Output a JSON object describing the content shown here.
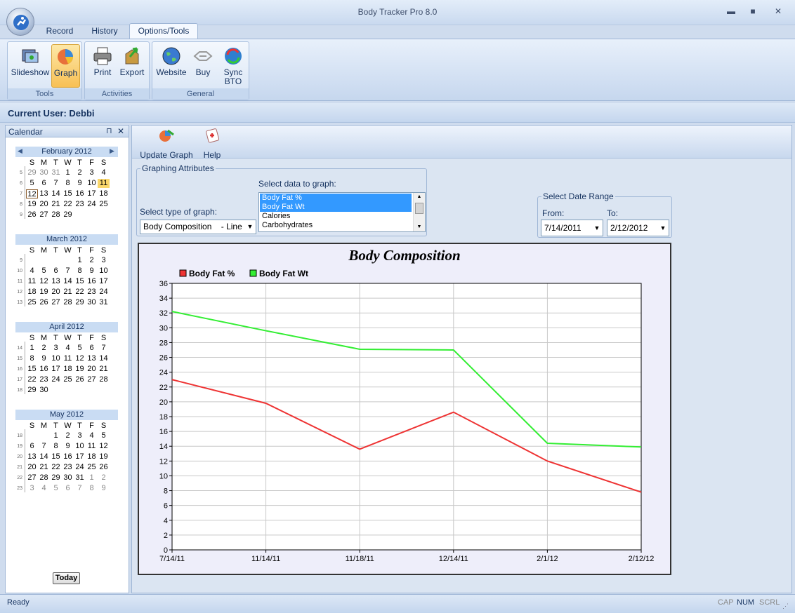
{
  "app": {
    "title": "Body Tracker Pro 8.0"
  },
  "window": {
    "minimize": "▬",
    "maximize": "■",
    "close": "✕"
  },
  "tabs": [
    {
      "label": "Record"
    },
    {
      "label": "History"
    },
    {
      "label": "Options/Tools",
      "active": true
    }
  ],
  "ribbon": {
    "groups": [
      {
        "label": "Tools",
        "buttons": [
          {
            "label": "Slideshow",
            "icon": "slideshow-icon"
          },
          {
            "label": "Graph",
            "icon": "graph-icon",
            "active": true
          }
        ]
      },
      {
        "label": "Activities",
        "buttons": [
          {
            "label": "Print",
            "icon": "printer-icon"
          },
          {
            "label": "Export",
            "icon": "export-icon"
          }
        ]
      },
      {
        "label": "General",
        "buttons": [
          {
            "label": "Website",
            "icon": "globe-icon"
          },
          {
            "label": "Buy",
            "icon": "buy-icon"
          },
          {
            "label": "Sync",
            "label2": "BTO",
            "icon": "sync-icon"
          }
        ]
      }
    ]
  },
  "user": {
    "label": "Current User: Debbi"
  },
  "calendar": {
    "title": "Calendar",
    "pin": "⊓",
    "close": "✕",
    "today_button": "Today",
    "days": [
      "S",
      "M",
      "T",
      "W",
      "T",
      "F",
      "S"
    ],
    "months": [
      {
        "name": "February 2012",
        "weeks": [
          [
            "5",
            "29",
            "30",
            "31",
            "1",
            "2",
            "3",
            "4"
          ],
          [
            "6",
            "5",
            "6",
            "7",
            "8",
            "9",
            "10",
            "11"
          ],
          [
            "7",
            "12",
            "13",
            "14",
            "15",
            "16",
            "17",
            "18"
          ],
          [
            "8",
            "19",
            "20",
            "21",
            "22",
            "23",
            "24",
            "25"
          ],
          [
            "9",
            "26",
            "27",
            "28",
            "29",
            "",
            "",
            ""
          ]
        ]
      },
      {
        "name": "March 2012",
        "weeks": [
          [
            "9",
            "",
            "",
            "",
            "",
            "1",
            "2",
            "3"
          ],
          [
            "10",
            "4",
            "5",
            "6",
            "7",
            "8",
            "9",
            "10"
          ],
          [
            "11",
            "11",
            "12",
            "13",
            "14",
            "15",
            "16",
            "17"
          ],
          [
            "12",
            "18",
            "19",
            "20",
            "21",
            "22",
            "23",
            "24"
          ],
          [
            "13",
            "25",
            "26",
            "27",
            "28",
            "29",
            "30",
            "31"
          ]
        ]
      },
      {
        "name": "April 2012",
        "weeks": [
          [
            "14",
            "1",
            "2",
            "3",
            "4",
            "5",
            "6",
            "7"
          ],
          [
            "15",
            "8",
            "9",
            "10",
            "11",
            "12",
            "13",
            "14"
          ],
          [
            "16",
            "15",
            "16",
            "17",
            "18",
            "19",
            "20",
            "21"
          ],
          [
            "17",
            "22",
            "23",
            "24",
            "25",
            "26",
            "27",
            "28"
          ],
          [
            "18",
            "29",
            "30",
            "",
            "",
            "",
            "",
            ""
          ]
        ]
      },
      {
        "name": "May 2012",
        "weeks": [
          [
            "18",
            "",
            "",
            "1",
            "2",
            "3",
            "4",
            "5"
          ],
          [
            "19",
            "6",
            "7",
            "8",
            "9",
            "10",
            "11",
            "12"
          ],
          [
            "20",
            "13",
            "14",
            "15",
            "16",
            "17",
            "18",
            "19"
          ],
          [
            "21",
            "20",
            "21",
            "22",
            "23",
            "24",
            "25",
            "26"
          ],
          [
            "22",
            "27",
            "28",
            "29",
            "30",
            "31",
            "1",
            "2"
          ],
          [
            "23",
            "3",
            "4",
            "5",
            "6",
            "7",
            "8",
            "9"
          ]
        ]
      }
    ]
  },
  "toolbar": {
    "update_graph": "Update Graph",
    "help": "Help"
  },
  "attributes": {
    "legend": "Graphing Attributes",
    "select_data_label": "Select data to graph:",
    "select_type_label": "Select type of graph:",
    "graph_type": "Body Composition",
    "graph_type_mode": "- Line",
    "data_items": [
      {
        "label": "Body Fat %",
        "selected": true
      },
      {
        "label": "Body Fat Wt",
        "selected": true
      },
      {
        "label": "Calories",
        "selected": false
      },
      {
        "label": "Carbohydrates",
        "selected": false
      }
    ]
  },
  "date_range": {
    "legend": "Select Date Range",
    "from_label": "From:",
    "to_label": "To:",
    "from": "7/14/2011",
    "to": "2/12/2012"
  },
  "chart_data": {
    "type": "line",
    "title": "Body Composition",
    "x": [
      "7/14/11",
      "11/14/11",
      "11/18/11",
      "12/14/11",
      "2/1/12",
      "2/12/12"
    ],
    "ylim": [
      0,
      36
    ],
    "ystep": 2,
    "grid": true,
    "legend_position": "top-left",
    "series": [
      {
        "name": "Body Fat %",
        "color": "#ee3333",
        "values": [
          23.0,
          19.8,
          13.6,
          18.6,
          12.0,
          7.8
        ]
      },
      {
        "name": "Body Fat Wt",
        "color": "#33ee33",
        "values": [
          32.2,
          29.6,
          27.1,
          27.0,
          14.4,
          13.9
        ]
      }
    ]
  },
  "status": {
    "text": "Ready",
    "cap": "CAP",
    "num": "NUM",
    "scrl": "SCRL"
  }
}
